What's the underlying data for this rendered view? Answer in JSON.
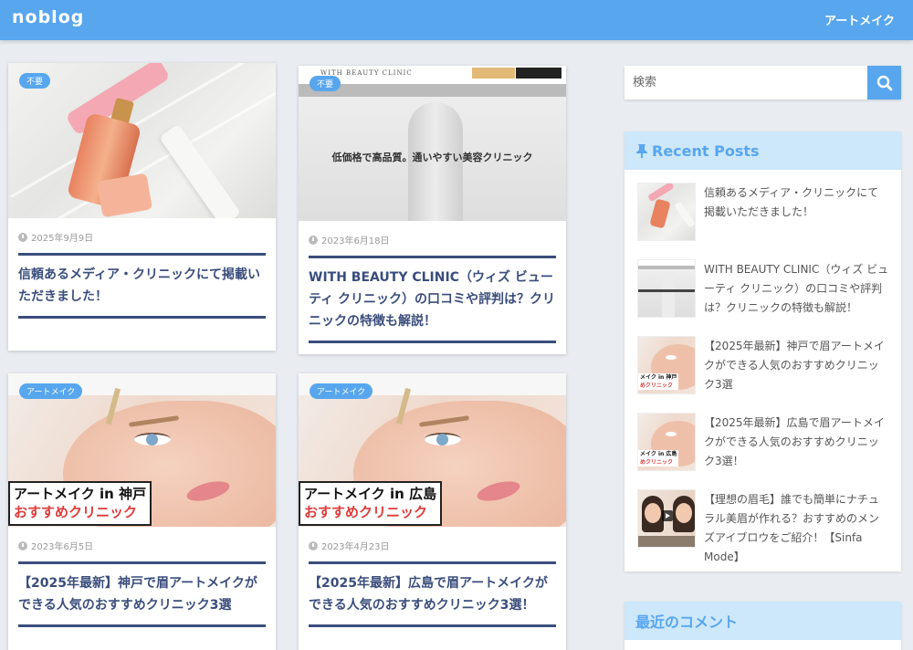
{
  "header": {
    "logo": "noblog",
    "nav": "アートメイク"
  },
  "cards": [
    {
      "badge": "不要",
      "date": "2025年9月9日",
      "title": "信頼あるメディア・クリニックにて掲載いただきました！"
    },
    {
      "badge": "不要",
      "date": "2023年6月18日",
      "title": "WITH BEAUTY CLINIC（ウィズ ビューティ クリニック）の口コミや評判は？クリニックの特徴も解説！",
      "thumb_text": {
        "logo": "WITH BEAUTY CLINIC",
        "headline": "低価格で高品質。通いやすい美容クリニック"
      }
    },
    {
      "badge": "アートメイク",
      "date": "2023年6月5日",
      "title": "【2025年最新】神戸で眉アートメイクができる人気のおすすめクリニック3選",
      "caption_line1": "アートメイク in 神戸",
      "caption_line2": "おすすめクリニック"
    },
    {
      "badge": "アートメイク",
      "date": "2023年4月23日",
      "title": "【2025年最新】広島で眉アートメイクができる人気のおすすめクリニック3選！",
      "caption_line1": "アートメイク in 広島",
      "caption_line2": "おすすめクリニック"
    }
  ],
  "search": {
    "placeholder": "検索"
  },
  "recent_posts": {
    "heading": "Recent Posts",
    "items": [
      {
        "title": "信頼あるメディア・クリニックにて掲載いただきました！"
      },
      {
        "title": "WITH BEAUTY CLINIC（ウィズ ビューティ クリニック）の口コミや評判は？クリニックの特徴も解説！"
      },
      {
        "title": "【2025年最新】神戸で眉アートメイクができる人気のおすすめクリニック3選",
        "mini1": "メイク in 神戸",
        "mini2": "めクリニック"
      },
      {
        "title": "【2025年最新】広島で眉アートメイクができる人気のおすすめクリニック3選！",
        "mini1": "メイク in 広島",
        "mini2": "めクリニック"
      },
      {
        "title": "【理想の眉毛】誰でも簡単にナチュラル美眉が作れる？おすすめのメンズアイブロウをご紹介！【Sinfa Mode】"
      }
    ]
  },
  "recent_comments": {
    "heading": "最近のコメント"
  },
  "colors": {
    "accent": "#57a6ee",
    "title": "#3a4d7c",
    "widget_head_bg": "#cde7fb"
  }
}
